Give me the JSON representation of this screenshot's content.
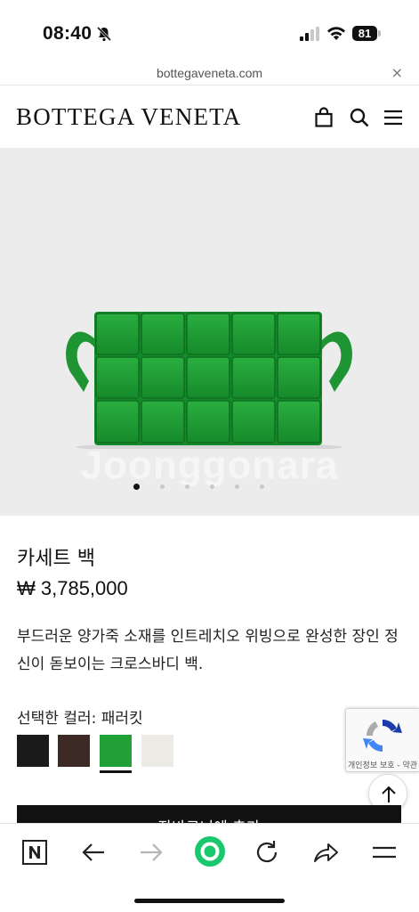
{
  "status_bar": {
    "time": "08:40",
    "battery": "81"
  },
  "browser": {
    "url": "bottegaveneta.com",
    "close_glyph": "×"
  },
  "header": {
    "brand": "BOTTEGA VENETA",
    "icons": [
      "shopping-bag-icon",
      "search-icon",
      "menu-icon"
    ]
  },
  "hero": {
    "watermark": "Joonggonara",
    "image_count": 6,
    "active_index": 0,
    "bag_color": "#1f9d33"
  },
  "product": {
    "name": "카세트 백",
    "price": "₩ 3,785,000",
    "description": "부드러운 양가죽 소재를 인트레치오 위빙으로 완성한 장인 정신이 돋보이는 크로스바디 백.",
    "color_label": "선택한 컬러: 패러킷",
    "swatches": [
      {
        "name": "black",
        "color": "#1a1a1a",
        "selected": false
      },
      {
        "name": "brown",
        "color": "#3b2a24",
        "selected": false
      },
      {
        "name": "parakeet",
        "color": "#21a038",
        "selected": true
      },
      {
        "name": "white",
        "color": "#ecebe6",
        "selected": false
      }
    ],
    "add_to_cart": "장바구니에 추가"
  },
  "recaptcha": {
    "label": "개인정보 보호 - 약관"
  },
  "toolbar": {
    "icons": [
      "naver-n-icon",
      "back-icon",
      "forward-icon",
      "green-dot-icon",
      "reload-icon",
      "share-icon",
      "menu-icon"
    ],
    "accent": "#19c86c"
  }
}
